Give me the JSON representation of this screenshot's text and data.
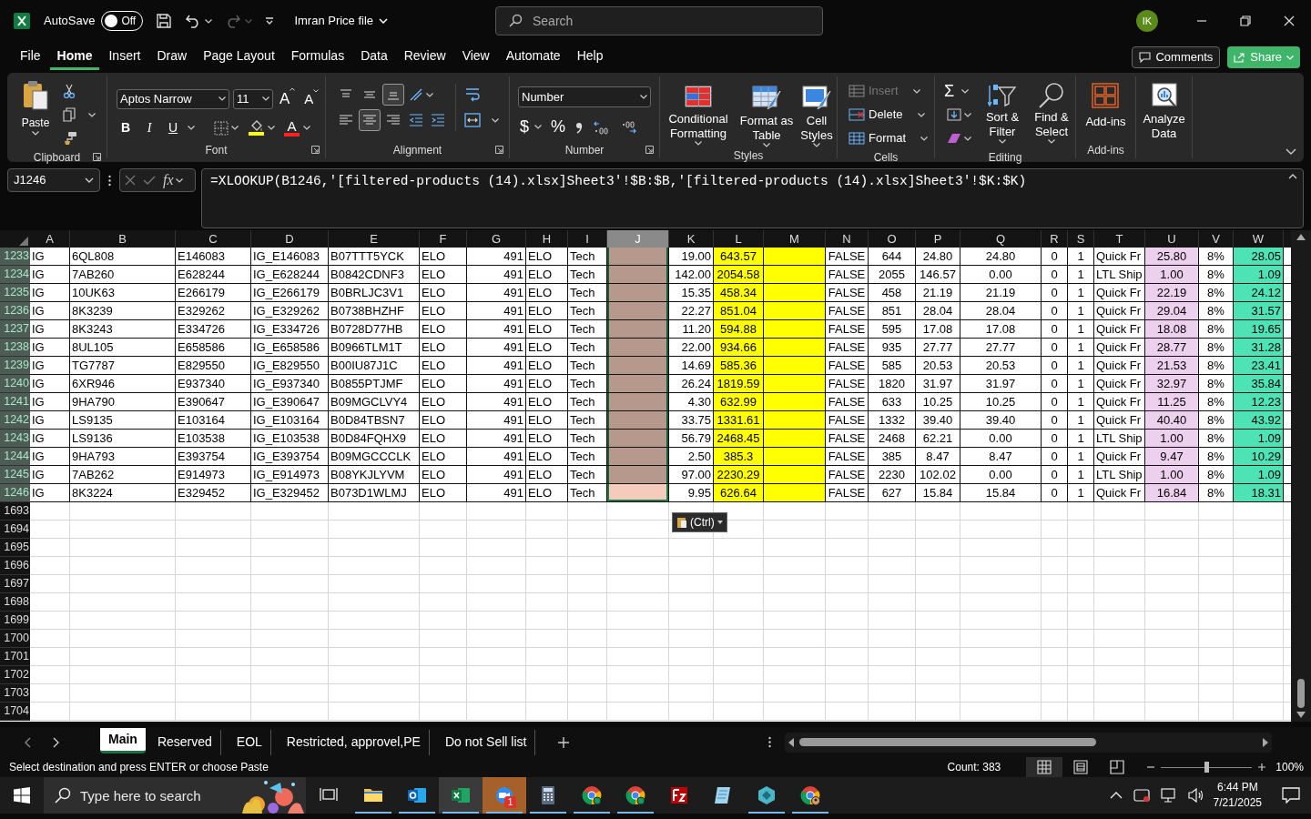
{
  "title_bar": {
    "autosave_label": "AutoSave",
    "autosave": {
      "label": "Off",
      "on": false
    },
    "file_name": "Imran Price file",
    "search": {
      "placeholder": "Search"
    },
    "avatar": "IK"
  },
  "menu_tabs": [
    {
      "label": "File",
      "selected": false
    },
    {
      "label": "Home",
      "selected": true
    },
    {
      "label": "Insert",
      "selected": false
    },
    {
      "label": "Draw",
      "selected": false
    },
    {
      "label": "Page Layout",
      "selected": false
    },
    {
      "label": "Formulas",
      "selected": false
    },
    {
      "label": "Data",
      "selected": false
    },
    {
      "label": "Review",
      "selected": false
    },
    {
      "label": "View",
      "selected": false
    },
    {
      "label": "Automate",
      "selected": false
    },
    {
      "label": "Help",
      "selected": false
    }
  ],
  "comments_button": "Comments",
  "share_button": "Share",
  "ribbon": {
    "groups": [
      {
        "kind": "clipboard",
        "label": "Clipboard",
        "paste": "Paste"
      },
      {
        "kind": "font",
        "label": "Font",
        "font_name": "Aptos Narrow",
        "font_size": "11",
        "grow": "A",
        "shrink": "A",
        "styles": [
          "B",
          "I",
          "U"
        ],
        "font_color": "A"
      },
      {
        "kind": "alignment",
        "label": "Alignment",
        "vertical": [
          {
            "selected": false
          },
          {
            "selected": false
          },
          {
            "selected": true
          }
        ],
        "horizontal": [
          {
            "selected": false
          },
          {
            "selected": true
          },
          {
            "selected": false
          }
        ]
      },
      {
        "kind": "number",
        "label": "Number",
        "format": "Number",
        "currency": "$",
        "percent": "%"
      },
      {
        "kind": "styles",
        "label": "Styles",
        "buttons": [
          "Conditional Formatting",
          "Format as Table",
          "Cell Styles"
        ]
      },
      {
        "kind": "cells",
        "label": "Cells",
        "items": [
          {
            "label": "Insert",
            "disabled": true
          },
          {
            "label": "Delete",
            "disabled": false
          },
          {
            "label": "Format",
            "disabled": false
          }
        ]
      },
      {
        "kind": "editing",
        "label": "Editing",
        "sum": "Σ",
        "buttons": [
          "Sort & Filter",
          "Find & Select"
        ]
      },
      {
        "kind": "addins",
        "label": "Add-ins",
        "button": "Add-ins"
      },
      {
        "kind": "analyze",
        "button": "Analyze Data"
      }
    ]
  },
  "formula_bar": {
    "name_box": "J1246",
    "fx": "fx",
    "formula": "=XLOOKUP(B1246,'[filtered-products (14).xlsx]Sheet3'!$B:$B,'[filtered-products (14).xlsx]Sheet3'!$K:$K)"
  },
  "grid": {
    "columns": [
      {
        "label": "A",
        "selected": false
      },
      {
        "label": "B",
        "selected": false
      },
      {
        "label": "C",
        "selected": false
      },
      {
        "label": "D",
        "selected": false
      },
      {
        "label": "E",
        "selected": false
      },
      {
        "label": "F",
        "selected": false
      },
      {
        "label": "G",
        "selected": false
      },
      {
        "label": "H",
        "selected": false
      },
      {
        "label": "I",
        "selected": false
      },
      {
        "label": "J",
        "selected": true,
        "color": "#f4cbbd"
      },
      {
        "label": "K",
        "selected": false
      },
      {
        "label": "L",
        "selected": false,
        "color": "#ffff00"
      },
      {
        "label": "M",
        "selected": false,
        "color": "#ffff00"
      },
      {
        "label": "N",
        "selected": false
      },
      {
        "label": "O",
        "selected": false
      },
      {
        "label": "P",
        "selected": false
      },
      {
        "label": "Q",
        "selected": false
      },
      {
        "label": "R",
        "selected": false
      },
      {
        "label": "S",
        "selected": false
      },
      {
        "label": "T",
        "selected": false
      },
      {
        "label": "U",
        "selected": false,
        "color": "#ecd0ee"
      },
      {
        "label": "V",
        "selected": false
      },
      {
        "label": "W",
        "selected": false,
        "color": "#4de3b5"
      }
    ],
    "rows": [
      {
        "number": "1233",
        "selected": true,
        "active": false,
        "cells": [
          "IG",
          "6QL808",
          "E146083",
          "IG_E146083",
          "B07TTT5YCK",
          "ELO",
          "491",
          "ELO",
          "Tech",
          null,
          "19.00",
          "643.57",
          null,
          "FALSE",
          "644",
          "24.80",
          "24.80",
          "0",
          "1",
          "Quick Fr",
          "25.80",
          "8%",
          "28.05"
        ]
      },
      {
        "number": "1234",
        "selected": true,
        "active": false,
        "cells": [
          "IG",
          "7AB260",
          "E628244",
          "IG_E628244",
          "B0842CDNF3",
          "ELO",
          "491",
          "ELO",
          "Tech",
          null,
          "142.00",
          "2054.58",
          null,
          "FALSE",
          "2055",
          "146.57",
          "0.00",
          "0",
          "1",
          "LTL Ship",
          "1.00",
          "8%",
          "1.09"
        ]
      },
      {
        "number": "1235",
        "selected": true,
        "active": false,
        "cells": [
          "IG",
          "10UK63",
          "E266179",
          "IG_E266179",
          "B0BRLJC3V1",
          "ELO",
          "491",
          "ELO",
          "Tech",
          null,
          "15.35",
          "458.34",
          null,
          "FALSE",
          "458",
          "21.19",
          "21.19",
          "0",
          "1",
          "Quick Fr",
          "22.19",
          "8%",
          "24.12"
        ]
      },
      {
        "number": "1236",
        "selected": true,
        "active": false,
        "cells": [
          "IG",
          "8K3239",
          "E329262",
          "IG_E329262",
          "B0738BHZHF",
          "ELO",
          "491",
          "ELO",
          "Tech",
          null,
          "22.27",
          "851.04",
          null,
          "FALSE",
          "851",
          "28.04",
          "28.04",
          "0",
          "1",
          "Quick Fr",
          "29.04",
          "8%",
          "31.57"
        ]
      },
      {
        "number": "1237",
        "selected": true,
        "active": false,
        "cells": [
          "IG",
          "8K3243",
          "E334726",
          "IG_E334726",
          "B0728D77HB",
          "ELO",
          "491",
          "ELO",
          "Tech",
          null,
          "11.20",
          "594.88",
          null,
          "FALSE",
          "595",
          "17.08",
          "17.08",
          "0",
          "1",
          "Quick Fr",
          "18.08",
          "8%",
          "19.65"
        ]
      },
      {
        "number": "1238",
        "selected": true,
        "active": false,
        "cells": [
          "IG",
          "8UL105",
          "E658586",
          "IG_E658586",
          "B0966TLM1T",
          "ELO",
          "491",
          "ELO",
          "Tech",
          null,
          "22.00",
          "934.66",
          null,
          "FALSE",
          "935",
          "27.77",
          "27.77",
          "0",
          "1",
          "Quick Fr",
          "28.77",
          "8%",
          "31.28"
        ]
      },
      {
        "number": "1239",
        "selected": true,
        "active": false,
        "cells": [
          "IG",
          "TG7787",
          "E829550",
          "IG_E829550",
          "B00IU87J1C",
          "ELO",
          "491",
          "ELO",
          "Tech",
          null,
          "14.69",
          "585.36",
          null,
          "FALSE",
          "585",
          "20.53",
          "20.53",
          "0",
          "1",
          "Quick Fr",
          "21.53",
          "8%",
          "23.41"
        ]
      },
      {
        "number": "1240",
        "selected": true,
        "active": false,
        "cells": [
          "IG",
          "6XR946",
          "E937340",
          "IG_E937340",
          "B0855PTJMF",
          "ELO",
          "491",
          "ELO",
          "Tech",
          null,
          "26.24",
          "1819.59",
          null,
          "FALSE",
          "1820",
          "31.97",
          "31.97",
          "0",
          "1",
          "Quick Fr",
          "32.97",
          "8%",
          "35.84"
        ]
      },
      {
        "number": "1241",
        "selected": true,
        "active": false,
        "cells": [
          "IG",
          "9HA790",
          "E390647",
          "IG_E390647",
          "B09MGCLVY4",
          "ELO",
          "491",
          "ELO",
          "Tech",
          null,
          "4.30",
          "632.99",
          null,
          "FALSE",
          "633",
          "10.25",
          "10.25",
          "0",
          "1",
          "Quick Fr",
          "11.25",
          "8%",
          "12.23"
        ]
      },
      {
        "number": "1242",
        "selected": true,
        "active": false,
        "cells": [
          "IG",
          "LS9135",
          "E103164",
          "IG_E103164",
          "B0D84TBSN7",
          "ELO",
          "491",
          "ELO",
          "Tech",
          null,
          "33.75",
          "1331.61",
          null,
          "FALSE",
          "1332",
          "39.40",
          "39.40",
          "0",
          "1",
          "Quick Fr",
          "40.40",
          "8%",
          "43.92"
        ]
      },
      {
        "number": "1243",
        "selected": true,
        "active": false,
        "cells": [
          "IG",
          "LS9136",
          "E103538",
          "IG_E103538",
          "B0D84FQHX9",
          "ELO",
          "491",
          "ELO",
          "Tech",
          null,
          "56.79",
          "2468.45",
          null,
          "FALSE",
          "2468",
          "62.21",
          "0.00",
          "0",
          "1",
          "LTL Ship",
          "1.00",
          "8%",
          "1.09"
        ]
      },
      {
        "number": "1244",
        "selected": true,
        "active": false,
        "cells": [
          "IG",
          "9HA793",
          "E393754",
          "IG_E393754",
          "B09MGCCCLK",
          "ELO",
          "491",
          "ELO",
          "Tech",
          null,
          "2.50",
          "385.3",
          null,
          "FALSE",
          "385",
          "8.47",
          "8.47",
          "0",
          "1",
          "Quick Fr",
          "9.47",
          "8%",
          "10.29"
        ]
      },
      {
        "number": "1245",
        "selected": true,
        "active": false,
        "cells": [
          "IG",
          "7AB262",
          "E914973",
          "IG_E914973",
          "B08YKJLYVM",
          "ELO",
          "491",
          "ELO",
          "Tech",
          null,
          "97.00",
          "2230.29",
          null,
          "FALSE",
          "2230",
          "102.02",
          "0.00",
          "0",
          "1",
          "LTL Ship",
          "1.00",
          "8%",
          "1.09"
        ]
      },
      {
        "number": "1246",
        "selected": true,
        "active": true,
        "cells": [
          "IG",
          "8K3224",
          "E329452",
          "IG_E329452",
          "B073D1WLMJ",
          "ELO",
          "491",
          "ELO",
          "Tech",
          null,
          "9.95",
          "626.64",
          null,
          "FALSE",
          "627",
          "15.84",
          "15.84",
          "0",
          "1",
          "Quick Fr",
          "16.84",
          "8%",
          "18.31"
        ]
      },
      {
        "number": "1693",
        "selected": false
      },
      {
        "number": "1694",
        "selected": false
      },
      {
        "number": "1695",
        "selected": false
      },
      {
        "number": "1696",
        "selected": false
      },
      {
        "number": "1697",
        "selected": false
      },
      {
        "number": "1698",
        "selected": false
      },
      {
        "number": "1699",
        "selected": false
      },
      {
        "number": "1700",
        "selected": false
      },
      {
        "number": "1701",
        "selected": false
      },
      {
        "number": "1702",
        "selected": false
      },
      {
        "number": "1703",
        "selected": false
      },
      {
        "number": "1704",
        "selected": false
      }
    ]
  },
  "paste_options": "(Ctrl)",
  "sheet_tabs": [
    {
      "label": "Main",
      "selected": true
    },
    {
      "label": "Reserved",
      "selected": false
    },
    {
      "label": "EOL",
      "selected": false
    },
    {
      "label": "Restricted, approvel,PE",
      "selected": false
    },
    {
      "label": "Do not Sell list",
      "selected": false
    }
  ],
  "status_bar": {
    "message": "Select destination and press ENTER or choose Paste",
    "count": "Count: 383",
    "views": [
      {
        "kind": "normal",
        "selected": true
      },
      {
        "kind": "page_layout",
        "selected": false
      },
      {
        "kind": "page_break",
        "selected": false
      }
    ],
    "zoom": {
      "level": 0.5
    },
    "zoom_label": "100%"
  },
  "taskbar": {
    "search": {
      "placeholder": "Type here to search"
    },
    "apps": [
      {
        "kind": "task_view",
        "selected": false,
        "running": false
      },
      {
        "kind": "folder",
        "selected": false,
        "running": true
      },
      {
        "kind": "outlook",
        "selected": false,
        "running": true
      },
      {
        "kind": "excel",
        "selected": true,
        "running": true
      },
      {
        "kind": "zoom",
        "selected": false,
        "running": true,
        "badge": "1"
      },
      {
        "kind": "calculator",
        "selected": false,
        "running": true
      },
      {
        "kind": "chrome",
        "selected": false,
        "running": true
      },
      {
        "kind": "chrome",
        "selected": false,
        "running": true
      },
      {
        "kind": "filezilla",
        "selected": false,
        "running": false
      },
      {
        "kind": "notepad",
        "selected": false,
        "running": false
      },
      {
        "kind": "diamond",
        "selected": false,
        "running": true
      },
      {
        "kind": "chrome_profile",
        "selected": false,
        "running": true
      }
    ],
    "time": "6:44 PM",
    "date": "7/21/2025"
  }
}
